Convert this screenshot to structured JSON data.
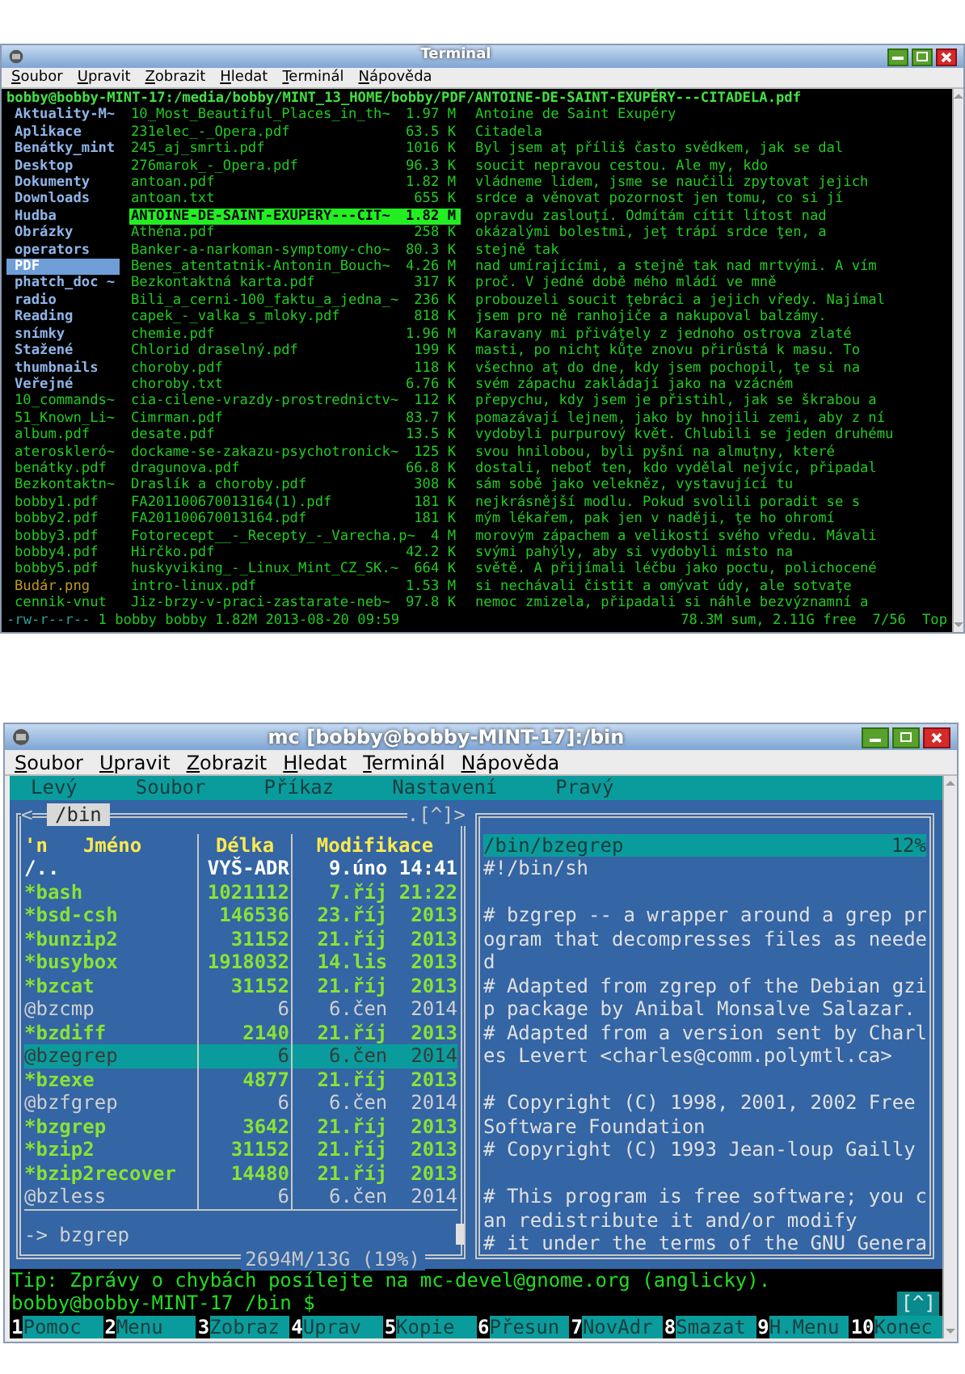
{
  "top_window": {
    "title": "Terminal",
    "menu": [
      "Soubor",
      "Upravit",
      "Zobrazit",
      "Hledat",
      "Terminál",
      "Nápověda"
    ],
    "header_line": "bobby@bobby-MINT-17:/media/bobby/MINT_13_HOME/bobby/PDF/ANTOINE-DE-SAINT-EXUPÉRY---CITADELA.pdf",
    "directories": [
      {
        "name": "Aktuality-M~",
        "kind": "directory",
        "selected": false
      },
      {
        "name": "Aplikace",
        "kind": "directory",
        "selected": false
      },
      {
        "name": "Benátky_mint",
        "kind": "directory",
        "selected": false
      },
      {
        "name": "Desktop",
        "kind": "directory",
        "selected": false
      },
      {
        "name": "Dokumenty",
        "kind": "directory",
        "selected": false
      },
      {
        "name": "Downloads",
        "kind": "directory",
        "selected": false
      },
      {
        "name": "Hudba",
        "kind": "directory",
        "selected": false
      },
      {
        "name": "Obrázky",
        "kind": "directory",
        "selected": false
      },
      {
        "name": "operators",
        "kind": "directory",
        "selected": false
      },
      {
        "name": "PDF",
        "kind": "directory",
        "selected": true
      },
      {
        "name": "phatch_doc ~",
        "kind": "directory",
        "selected": false
      },
      {
        "name": "radio",
        "kind": "directory",
        "selected": false
      },
      {
        "name": "Reading",
        "kind": "directory",
        "selected": false
      },
      {
        "name": "snímky",
        "kind": "directory",
        "selected": false
      },
      {
        "name": "Stažené",
        "kind": "directory",
        "selected": false
      },
      {
        "name": "thumbnails",
        "kind": "directory",
        "selected": false
      },
      {
        "name": "Veřejné",
        "kind": "directory",
        "selected": false
      },
      {
        "name": "10_commands~",
        "kind": "file",
        "selected": false
      },
      {
        "name": "51_Known_Li~",
        "kind": "file",
        "selected": false
      },
      {
        "name": "album.pdf",
        "kind": "file",
        "selected": false
      },
      {
        "name": "ateroskleró~",
        "kind": "file",
        "selected": false
      },
      {
        "name": "benátky.pdf",
        "kind": "file",
        "selected": false
      },
      {
        "name": "Bezkontaktn~",
        "kind": "file",
        "selected": false
      },
      {
        "name": "bobby1.pdf",
        "kind": "file",
        "selected": false
      },
      {
        "name": "bobby2.pdf",
        "kind": "file",
        "selected": false
      },
      {
        "name": "bobby3.pdf",
        "kind": "file",
        "selected": false
      },
      {
        "name": "bobby4.pdf",
        "kind": "file",
        "selected": false
      },
      {
        "name": "bobby5.pdf",
        "kind": "file",
        "selected": false
      },
      {
        "name": "Budár.png",
        "kind": "image",
        "selected": false
      },
      {
        "name": "cennik-vnut",
        "kind": "file",
        "selected": false
      }
    ],
    "files": [
      {
        "name": "10_Most_Beautiful_Places_in_th~",
        "size": "1.97 M",
        "selected": false
      },
      {
        "name": "231elec_-_Opera.pdf",
        "size": "63.5 K",
        "selected": false
      },
      {
        "name": "245_aj_smrti.pdf",
        "size": "1016 K",
        "selected": false
      },
      {
        "name": "276marok_-_Opera.pdf",
        "size": "96.3 K",
        "selected": false
      },
      {
        "name": "antoan.pdf",
        "size": "1.82 M",
        "selected": false
      },
      {
        "name": "antoan.txt",
        "size": "655 K",
        "selected": false
      },
      {
        "name": "ANTOINE-DE-SAINT-EXUPÉRY---CIT~",
        "size": "1.82 M",
        "selected": true
      },
      {
        "name": "Athéna.pdf",
        "size": "258 K",
        "selected": false
      },
      {
        "name": "Banker-a-narkoman-symptomy-cho~",
        "size": "80.3 K",
        "selected": false
      },
      {
        "name": "Benes_atentatnik-Antonin_Bouch~",
        "size": "4.26 M",
        "selected": false
      },
      {
        "name": "Bezkontaktná karta.pdf",
        "size": "317 K",
        "selected": false
      },
      {
        "name": "Bili_a_cerni-100_faktu_a_jedna_~",
        "size": "236 K",
        "selected": false
      },
      {
        "name": "capek_-_valka_s_mloky.pdf",
        "size": "818 K",
        "selected": false
      },
      {
        "name": "chemie.pdf",
        "size": "1.96 M",
        "selected": false
      },
      {
        "name": "Chlorid draselný.pdf",
        "size": "199 K",
        "selected": false
      },
      {
        "name": "choroby.pdf",
        "size": "118 K",
        "selected": false
      },
      {
        "name": "choroby.txt",
        "size": "6.76 K",
        "selected": false
      },
      {
        "name": "cia-cilene-vrazdy-prostrednictv~",
        "size": "112 K",
        "selected": false
      },
      {
        "name": "Cimrman.pdf",
        "size": "83.7 K",
        "selected": false
      },
      {
        "name": "desate.pdf",
        "size": "13.5 K",
        "selected": false
      },
      {
        "name": "dockame-se-zakazu-psychotronick~",
        "size": "125 K",
        "selected": false
      },
      {
        "name": "dragunova.pdf",
        "size": "66.8 K",
        "selected": false
      },
      {
        "name": "Draslík a choroby.pdf",
        "size": "308 K",
        "selected": false
      },
      {
        "name": "FA201100670013164(1).pdf",
        "size": "181 K",
        "selected": false
      },
      {
        "name": "FA201100670013164.pdf",
        "size": "181 K",
        "selected": false
      },
      {
        "name": "Fotorecept__-_Recepty_-_Varecha.p~",
        "size": "4 M",
        "selected": false
      },
      {
        "name": "Hirčko.pdf",
        "size": "42.2 K",
        "selected": false
      },
      {
        "name": "huskyviking_-_Linux_Mint_CZ_SK.~",
        "size": "664 K",
        "selected": false
      },
      {
        "name": "intro-linux.pdf",
        "size": "1.53 M",
        "selected": false
      },
      {
        "name": "Jiz-brzy-v-praci-zastarate-neb~",
        "size": "97.8 K",
        "selected": false
      }
    ],
    "preview_lines": [
      "Antoine de Saint Exupéry",
      "Citadela",
      "Byl jsem aţ příliš často svědkem, jak se dal",
      "soucit nepravou cestou. Ale my, kdo",
      "vládneme lidem, jsme se naučili zpytovat jejich",
      "srdce a věnovat pozornost jen tomu, co si jí",
      "opravdu zaslouţí. Odmítám cítit lítost nad",
      "okázalými bolestmi, jeţ trápí srdce ţen, a",
      "stejně tak",
      "nad umírajícími, a stejně tak nad mrtvými. A vím",
      "proč. V jedné době mého mládí ve mně",
      "probouzeli soucit ţebráci a jejich vředy. Najímal",
      "jsem pro ně ranhojiče a nakupoval balzámy.",
      "Karavany mi přiváţely z jednoho ostrova zlaté",
      "masti, po nichţ kůţe znovu přirůstá k masu. To",
      "všechno aţ do dne, kdy jsem pochopil, ţe si na",
      "svém zápachu zakládají jako na vzácném",
      "přepychu, kdy jsem je přistihl, jak se škrabou a",
      "pomazávají lejnem, jako by hnojili zemi, aby z ní",
      "vydobyli purpurový květ. Chlubili se jeden druhému",
      "svou hnilobou, byli pyšní na almuţny, které",
      "dostali, neboť ten, kdo vydělal nejvíc, připadal",
      "sám sobě jako velekněz, vystavující tu",
      "nejkrásnější modlu. Pokud svolili poradit se s",
      "mým lékařem, pak jen v naději, ţe ho ohromí",
      "morovým zápachem a velikostí svého vředu. Mávali",
      "svými pahýly, aby si vydobyli místo na",
      "světě. A přijímali léčbu jako poctu, polichocené",
      "si nechávali čistit a omývat údy, ale sotvaţe",
      "nemoc zmizela, připadali si náhle bezvýznamní a"
    ],
    "status": {
      "permissions": "-rw-r--r--",
      "info": "1 bobby bobby 1.82M 2013-08-20 09:59",
      "summary": "78.3M sum, 2.11G free",
      "position": "7/56",
      "scroll": "Top"
    }
  },
  "bottom_window": {
    "title": "mc [bobby@bobby-MINT-17]:/bin",
    "menu": [
      "Soubor",
      "Upravit",
      "Zobrazit",
      "Hledat",
      "Terminál",
      "Nápověda"
    ],
    "mc_menu": [
      "Levý",
      "Soubor",
      "Příkaz",
      "Nastavení",
      "Pravý"
    ],
    "left_panel": {
      "path": "/bin",
      "left_arrow": "<",
      "corner": ".[^]>",
      "columns": [
        "'n",
        "Jméno",
        "Délka",
        "Modifikace"
      ],
      "rows": [
        {
          "name": "/..",
          "size": "VYŠ-ADR",
          "modified": "9.úno 14:41",
          "kind": "updir",
          "selected": false
        },
        {
          "name": "*bash",
          "size": "1021112",
          "modified": "7.říj 21:22",
          "kind": "executable",
          "selected": false
        },
        {
          "name": "*bsd-csh",
          "size": "146536",
          "modified": "23.říj  2013",
          "kind": "executable",
          "selected": false
        },
        {
          "name": "*bunzip2",
          "size": "31152",
          "modified": "21.říj  2013",
          "kind": "executable",
          "selected": false
        },
        {
          "name": "*busybox",
          "size": "1918032",
          "modified": "14.lis  2013",
          "kind": "executable",
          "selected": false
        },
        {
          "name": "*bzcat",
          "size": "31152",
          "modified": "21.říj  2013",
          "kind": "executable",
          "selected": false
        },
        {
          "name": "@bzcmp",
          "size": "6",
          "modified": "6.čen  2014",
          "kind": "link",
          "selected": false
        },
        {
          "name": "*bzdiff",
          "size": "2140",
          "modified": "21.říj  2013",
          "kind": "executable",
          "selected": false
        },
        {
          "name": "@bzegrep",
          "size": "6",
          "modified": "6.čen  2014",
          "kind": "link",
          "selected": true
        },
        {
          "name": "*bzexe",
          "size": "4877",
          "modified": "21.říj  2013",
          "kind": "executable",
          "selected": false
        },
        {
          "name": "@bzfgrep",
          "size": "6",
          "modified": "6.čen  2014",
          "kind": "link",
          "selected": false
        },
        {
          "name": "*bzgrep",
          "size": "3642",
          "modified": "21.říj  2013",
          "kind": "executable",
          "selected": false
        },
        {
          "name": "*bzip2",
          "size": "31152",
          "modified": "21.říj  2013",
          "kind": "executable",
          "selected": false
        },
        {
          "name": "*bzip2recover",
          "size": "14480",
          "modified": "21.říj  2013",
          "kind": "executable",
          "selected": false
        },
        {
          "name": "@bzless",
          "size": "6",
          "modified": "6.čen  2014",
          "kind": "link",
          "selected": false
        }
      ],
      "mini_status": "-> bzgrep",
      "disk_usage": "2694M/13G (19%)"
    },
    "viewer": {
      "file": "/bin/bzegrep",
      "percent": "12%",
      "paragraphs": [
        [
          "#!/bin/sh"
        ],
        [
          "# bzgrep -- a wrapper around a grep pr",
          "ogram that decompresses files as neede",
          "d",
          "# Adapted from zgrep of the Debian gzi",
          "p package by Anibal Monsalve Salazar.",
          "# Adapted from a version sent by Charl",
          "es Levert <charles@comm.polymtl.ca>"
        ],
        [
          "# Copyright (C) 1998, 2001, 2002 Free",
          "Software Foundation",
          "# Copyright (C) 1993 Jean-loup Gailly"
        ],
        [
          "# This program is free software; you c",
          "an redistribute it and/or modify",
          "# it under the terms of the GNU Genera"
        ]
      ]
    },
    "tip": "Tip: Zprávy o chybách posílejte na mc-devel@gnome.org (anglicky).",
    "prompt": "bobby@bobby-MINT-17 /bin $",
    "corner": "[^]",
    "function_keys": [
      {
        "number": "1",
        "label": "Pomoc"
      },
      {
        "number": "2",
        "label": "Menu"
      },
      {
        "number": "3",
        "label": "Zobraz"
      },
      {
        "number": "4",
        "label": "Uprav"
      },
      {
        "number": "5",
        "label": "Kopie"
      },
      {
        "number": "6",
        "label": "Přesun"
      },
      {
        "number": "7",
        "label": "NovAdr"
      },
      {
        "number": "8",
        "label": "Smazat"
      },
      {
        "number": "9",
        "label": "H.Menu"
      },
      {
        "number": "10",
        "label": "Konec"
      }
    ]
  }
}
